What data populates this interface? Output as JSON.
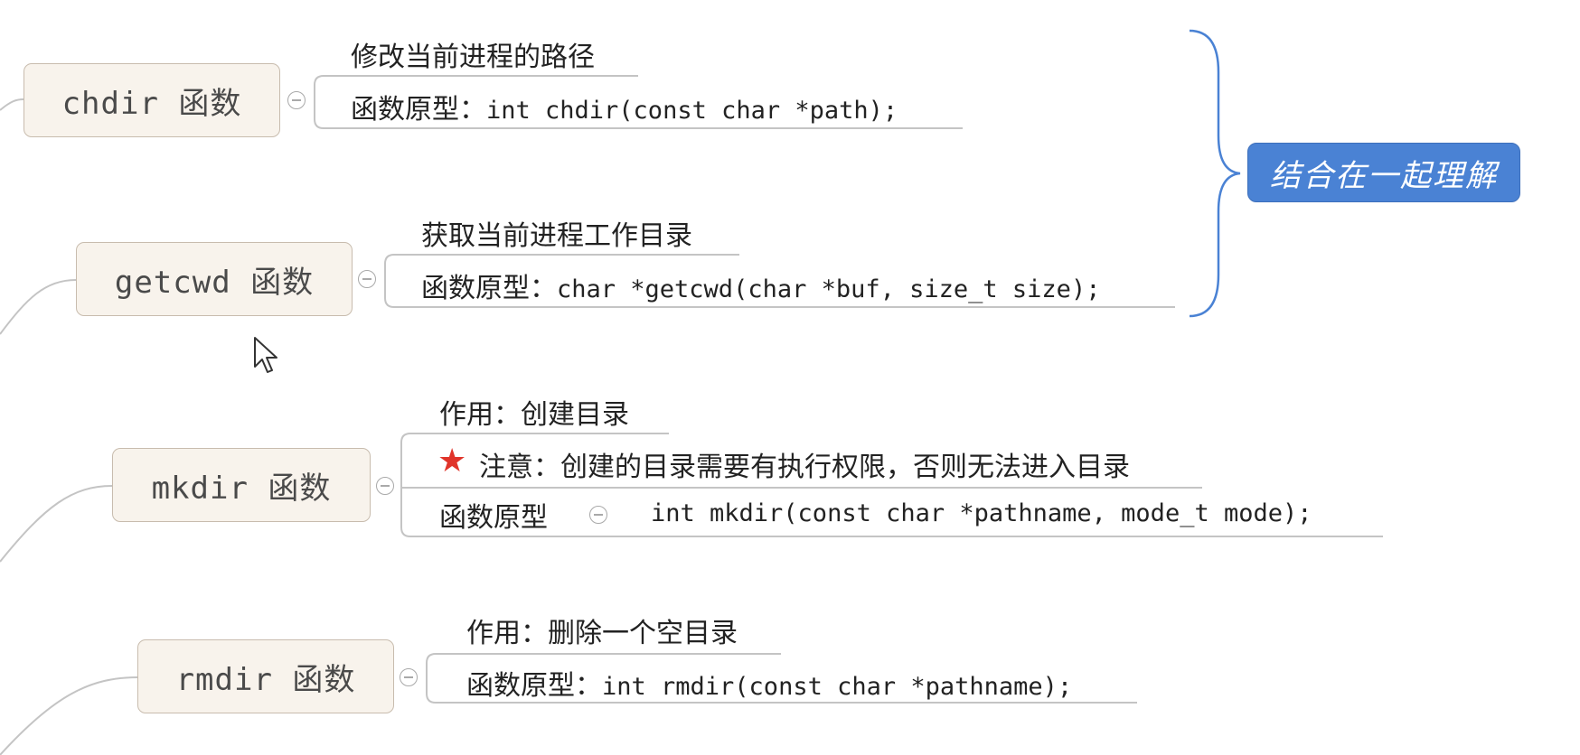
{
  "nodes": {
    "chdir": {
      "title": "chdir 函数",
      "desc": "修改当前进程的路径",
      "proto_label": "函数原型：",
      "proto": "int chdir(const char *path);"
    },
    "getcwd": {
      "title": "getcwd 函数",
      "desc": "获取当前进程工作目录",
      "proto_label": "函数原型：",
      "proto": "char *getcwd(char *buf, size_t size);"
    },
    "mkdir": {
      "title": "mkdir 函数",
      "desc": "作用：创建目录",
      "note": "注意：创建的目录需要有执行权限，否则无法进入目录",
      "proto_label": "函数原型",
      "proto": "int mkdir(const char *pathname, mode_t mode);"
    },
    "rmdir": {
      "title": "rmdir 函数",
      "desc": "作用：删除一个空目录",
      "proto_label": "函数原型：",
      "proto": "int rmdir(const char *pathname);"
    }
  },
  "summary": {
    "label": "结合在一起理解",
    "fill": "#4a82d4",
    "text_color": "#ffffff"
  },
  "icons": {
    "collapse": "collapse-toggle-icon",
    "star": "star-marker-icon",
    "cursor": "mouse-pointer-icon"
  },
  "colors": {
    "node_fill": "#f8f3ec",
    "node_border": "#c8bcae",
    "connector": "#c0c0c0",
    "brace": "#4a82d4",
    "star": "#e0342a"
  }
}
